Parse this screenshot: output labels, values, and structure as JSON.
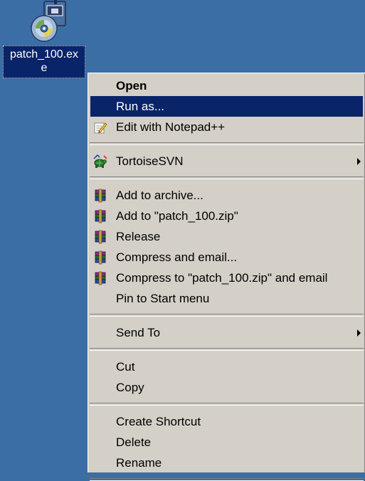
{
  "desktop": {
    "file_name": "patch_100.exe",
    "file_name_line1": "patch_100.ex",
    "file_name_line2": "e",
    "file_icon": "installer-icon"
  },
  "context_menu": {
    "groups": [
      [
        {
          "label": "Open",
          "bold": true
        },
        {
          "label": "Run as...",
          "highlighted": true
        },
        {
          "label": "Edit with Notepad++",
          "icon": "notepadpp-icon"
        }
      ],
      [
        {
          "label": "TortoiseSVN",
          "icon": "tortoisesvn-icon",
          "submenu": true
        }
      ],
      [
        {
          "label": "Add to archive...",
          "icon": "winrar-icon"
        },
        {
          "label": "Add to \"patch_100.zip\"",
          "icon": "winrar-icon"
        },
        {
          "label": "Release",
          "icon": "winrar-icon"
        },
        {
          "label": "Compress and email...",
          "icon": "winrar-icon"
        },
        {
          "label": "Compress to \"patch_100.zip\" and email",
          "icon": "winrar-icon"
        },
        {
          "label": "Pin to Start menu"
        }
      ],
      [
        {
          "label": "Send To",
          "submenu": true
        }
      ],
      [
        {
          "label": "Cut"
        },
        {
          "label": "Copy"
        }
      ],
      [
        {
          "label": "Create Shortcut"
        },
        {
          "label": "Delete"
        },
        {
          "label": "Rename"
        }
      ]
    ]
  },
  "colors": {
    "desktop": "#3a6ea5",
    "menu_bg": "#d4d0c8",
    "highlight": "#0a246a"
  }
}
